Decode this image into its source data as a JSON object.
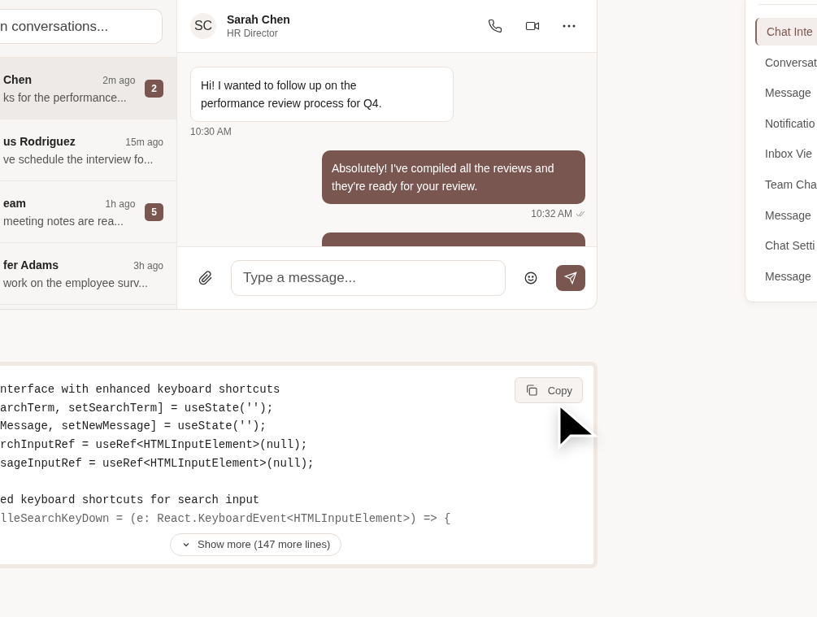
{
  "search": {
    "placeholder": "n conversations..."
  },
  "conversations": [
    {
      "name": "Chen",
      "time": "2m ago",
      "preview": "ks for the performance...",
      "unread": "2",
      "selected": true
    },
    {
      "name": "us Rodriguez",
      "time": "15m ago",
      "preview": "ve schedule the interview fo...",
      "selected": false
    },
    {
      "name": "eam",
      "time": "1h ago",
      "preview": "meeting notes are rea...",
      "unread": "5",
      "selected": false
    },
    {
      "name": "fer Adams",
      "time": "3h ago",
      "preview": "work on the employee surv...",
      "selected": false
    }
  ],
  "chat": {
    "initials": "SC",
    "name": "Sarah Chen",
    "role": "HR Director",
    "messages": [
      {
        "kind": "received",
        "text": "Hi! I wanted to follow up on the performance review process for Q4.",
        "time": "10:30 AM",
        "read": false
      },
      {
        "kind": "sent",
        "text": "Absolutely! I've compiled all the reviews and they're ready for your review.",
        "time": "10:32 AM",
        "read": true
      },
      {
        "kind": "sent"
      }
    ],
    "composer": {
      "placeholder": "Type a message..."
    }
  },
  "nav": [
    {
      "label": "Chat Inte",
      "selected": true
    },
    {
      "label": "Conversat",
      "selected": false
    },
    {
      "label": "Message",
      "selected": false
    },
    {
      "label": "Notificatio",
      "selected": false
    },
    {
      "label": "Inbox Vie",
      "selected": false
    },
    {
      "label": "Team Cha",
      "selected": false
    },
    {
      "label": "Message",
      "selected": false
    },
    {
      "label": "Chat Setti",
      "selected": false
    },
    {
      "label": "Message",
      "selected": false
    }
  ],
  "code": {
    "copy": "Copy",
    "lines": [
      {
        "text": "nterface with enhanced keyboard shortcuts",
        "blank_before": false
      },
      {
        "text": "archTerm, setSearchTerm] = useState('');",
        "blank_before": false
      },
      {
        "text": "Message, setNewMessage] = useState('');",
        "blank_before": false
      },
      {
        "text": "rchInputRef = useRef<HTMLInputElement>(null);",
        "blank_before": false
      },
      {
        "text": "sageInputRef = useRef<HTMLInputElement>(null);",
        "blank_before": false
      },
      {
        "text": "ed keyboard shortcuts for search input",
        "blank_before": true
      },
      {
        "text": "lleSearchKeyDown = (e: React.KeyboardEvent<HTMLInputElement>) => {",
        "blank_before": false
      }
    ],
    "show_more": "Show more (147 more lines)"
  }
}
